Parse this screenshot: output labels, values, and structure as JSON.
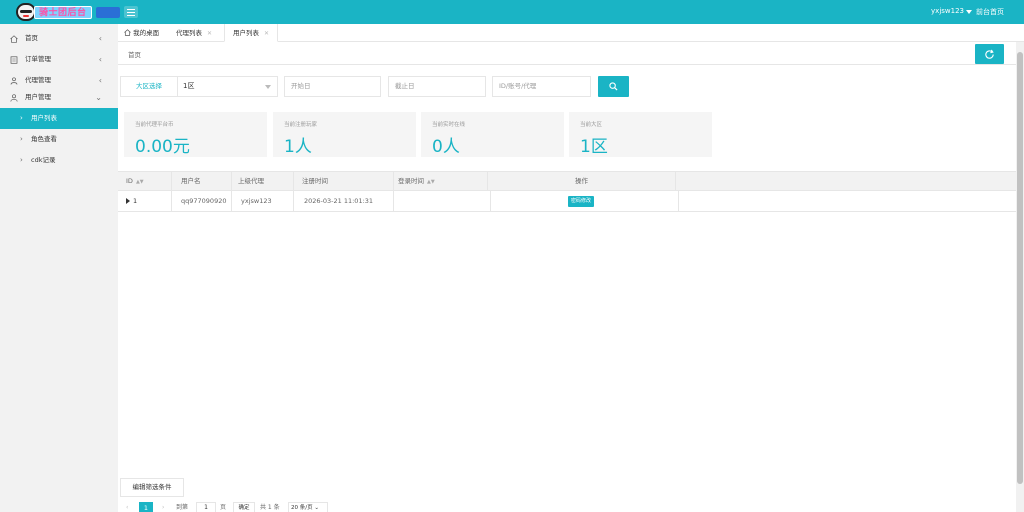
{
  "header": {
    "logo_text": "骑士团后台",
    "user_name": "yxjsw123",
    "front_link": "前台首页"
  },
  "sidebar": {
    "items": [
      {
        "label": "首页",
        "icon": "home-icon",
        "arrow": "‹"
      },
      {
        "label": "订单管理",
        "icon": "order-icon",
        "arrow": "‹"
      },
      {
        "label": "代理管理",
        "icon": "agent-icon",
        "arrow": "‹"
      },
      {
        "label": "用户管理",
        "icon": "user-icon",
        "arrow": "⌄"
      }
    ],
    "sub_items": [
      {
        "label": "用户列表",
        "active": true
      },
      {
        "label": "角色查看",
        "active": false
      },
      {
        "label": "cdk记录",
        "active": false
      }
    ]
  },
  "tabs": [
    {
      "label": "我的桌面"
    },
    {
      "label": "代理列表"
    },
    {
      "label": "用户列表"
    }
  ],
  "breadcrumb": "首页",
  "filters": {
    "region_label": "大区选择",
    "region_value": "1区",
    "start_placeholder": "开始日",
    "end_placeholder": "截止日",
    "id_placeholder": "ID/账号/代理"
  },
  "stats": [
    {
      "label": "当前代理平台币",
      "value": "0.00元"
    },
    {
      "label": "当前注册玩家",
      "value": "1人"
    },
    {
      "label": "当前实时在线",
      "value": "0人"
    },
    {
      "label": "当前大区",
      "value": "1区"
    }
  ],
  "table": {
    "columns": [
      "ID",
      "用户名",
      "上级代理",
      "注册时间",
      "登录时间",
      "操作"
    ],
    "rows": [
      {
        "id": "1",
        "username": "qq977090920",
        "parent": "yxjsw123",
        "reg_time": "2026-03-21 11:01:31",
        "login_time": "",
        "action": "密码修改"
      }
    ]
  },
  "footer": {
    "edit_filter": "编辑筛选条件"
  },
  "pager": {
    "current": "1",
    "goto_label": "到第",
    "goto_value": "1",
    "page_unit": "页",
    "confirm": "确定",
    "total": "共 1 条",
    "page_size": "20 条/页"
  },
  "colors": {
    "accent": "#1ab4c5",
    "sidebar_bg": "#f2f2f2"
  }
}
